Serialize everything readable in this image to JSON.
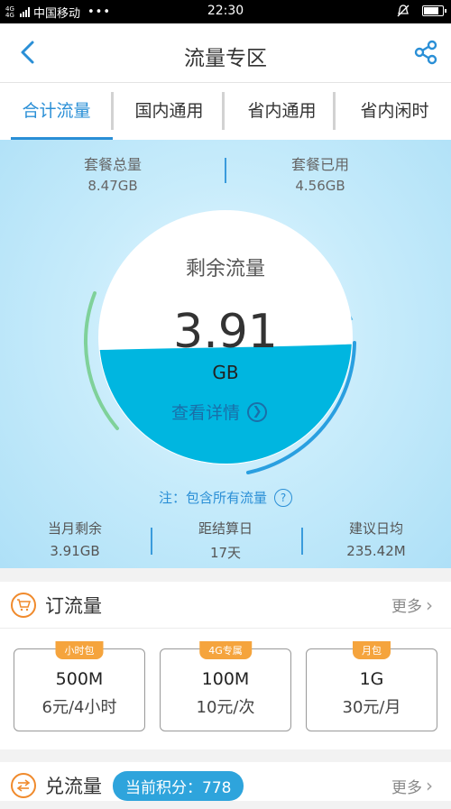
{
  "status_bar": {
    "network": "4G 4G",
    "carrier": "中国移动",
    "dots": "•••",
    "time": "22:30"
  },
  "header": {
    "title": "流量专区"
  },
  "tabs": [
    {
      "label": "合计流量"
    },
    {
      "label": "国内通用"
    },
    {
      "label": "省内通用"
    },
    {
      "label": "省内闲时"
    }
  ],
  "summary": {
    "total_label": "套餐总量",
    "total_value": "8.47GB",
    "used_label": "套餐已用",
    "used_value": "4.56GB"
  },
  "gauge": {
    "label": "剩余流量",
    "value": "3.91",
    "unit": "GB",
    "detail_link": "查看详情",
    "remaining_fraction": 0.46
  },
  "note": {
    "text": "注：包含所有流量",
    "help_icon": "?"
  },
  "stats": [
    {
      "label": "当月剩余",
      "value": "3.91GB"
    },
    {
      "label": "距结算日",
      "value": "17天"
    },
    {
      "label": "建议日均",
      "value": "235.42M"
    }
  ],
  "order_section": {
    "title": "订流量",
    "more": "更多",
    "packages": [
      {
        "tag": "小时包",
        "size": "500M",
        "price": "6元/4小时"
      },
      {
        "tag": "4G专属",
        "size": "100M",
        "price": "10元/次"
      },
      {
        "tag": "月包",
        "size": "1G",
        "price": "30元/月"
      }
    ]
  },
  "exchange_section": {
    "title": "兑流量",
    "points": "当前积分：778",
    "more": "更多"
  },
  "colors": {
    "accent": "#2a8fd6",
    "orange": "#f08a2c",
    "water": "#00b6e0"
  }
}
